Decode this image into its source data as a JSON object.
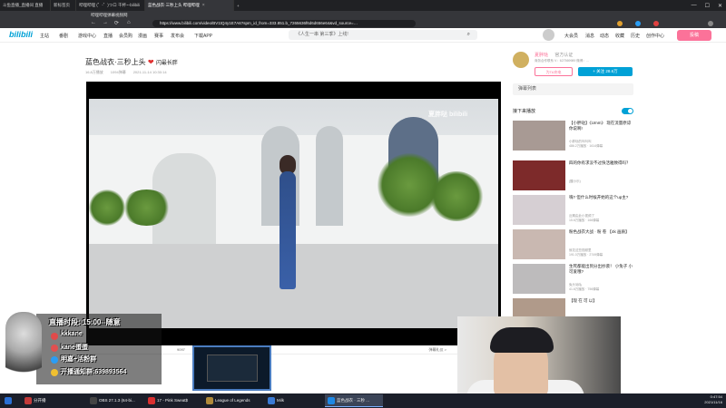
{
  "browser": {
    "tabs": [
      {
        "label": "斗鱼直播_直播间 直播",
        "active": false
      },
      {
        "label": "新标签页",
        "active": false
      },
      {
        "label": "哔哩哔哩 (゜-゜)つロ 干杯~-bilibili",
        "active": false
      },
      {
        "label": "蓝色战衣·三秒上头 哔哩哔哩",
        "active": true
      }
    ],
    "new_tab": "+",
    "bookmarks": [
      "哔哩哔哩弹幕视频网"
    ],
    "url": "https://www.bilibili.com/video/BV1tQ4y1E7A6?spm_id_from=333.851.b_7265636f6d6d656e64&vd_source=…",
    "window_controls": [
      "—",
      "☐",
      "✕"
    ]
  },
  "bilibili": {
    "logo": "bilibili",
    "nav": [
      "主站",
      "番剧",
      "游戏中心",
      "直播",
      "会员购",
      "漫画",
      "赛事",
      "发布会",
      "下载APP"
    ],
    "search_placeholder": "《人生一串 第三季》上线!",
    "right_nav": [
      "大会员",
      "消息",
      "动态",
      "收藏",
      "历史",
      "创作中心"
    ],
    "upload_label": "投稿",
    "video": {
      "title": "蓝色战衣·三秒上头",
      "title_suffix": "闪最长胖",
      "meta": [
        "16.8万播放",
        "1094弹幕",
        "2021-11-14 10:30:14"
      ],
      "watermark": "夏胖哒   bilibili",
      "viewers": "9097",
      "send_label": "弹幕礼仪 >"
    },
    "up": {
      "name": "夏胖哒",
      "verified": "官方认证",
      "desc": "商务合作联系 V：627569989 微博：...",
      "charge": "为TA充电",
      "follow": "+ 关注 28.6万"
    },
    "danmaku_list": "弹幕列表",
    "autoplay": "接下来播放",
    "recommendations": [
      {
        "title": "【小胖哒】《Umm》 现在流量原谅你说啊!",
        "up": "小胖哒的叫叫叫",
        "stats": "486.2万播放 · 1614弹幕"
      },
      {
        "title": "四的你有求没不过快活雅致得吗？",
        "up": "(醒小乐)",
        "stats": ""
      },
      {
        "title": "嗨? 但什么时候开始的这个up主?",
        "up": "近期由此小视频了",
        "stats": "15.6万播放 · 166弹幕"
      },
      {
        "title": "粉色战衣大战 · 粉 卷 【4k 画质】",
        "up": "就花这些视频里",
        "stats": "191.0万播放 · 2749弹幕"
      },
      {
        "title": "生死都能出到分出抄袭！ 小兔子 小可爱哦?",
        "up": "兔头咕咕",
        "stats": "41.6万播放 · 756弹幕"
      },
      {
        "title": "【现 在 可 以】",
        "up": "",
        "stats": ""
      }
    ]
  },
  "overlay": {
    "lines": [
      "直播时段: 15:00--随意",
      "kkkane",
      "kane蛋蛋",
      "明嘉+活粉群",
      "开播通知群:639893564"
    ]
  },
  "taskbar": {
    "items": [
      {
        "label": "",
        "color": "#2a6fd4"
      },
      {
        "label": "分开播",
        "color": "#c23a3a"
      },
      {
        "label": "OBS 27.1.3 (64-bi...",
        "color": "#444444"
      },
      {
        "label": "17 - Pink Sweat$",
        "color": "#d93030"
      },
      {
        "label": "League of Legends",
        "color": "#b08a3a"
      },
      {
        "label": "Milk",
        "color": "#3a7ad4"
      },
      {
        "label": "蓝色战衣 · 三秒 ...",
        "color": "#1e88e5"
      }
    ],
    "time": "0:47:54",
    "date": "2021/11/16"
  }
}
